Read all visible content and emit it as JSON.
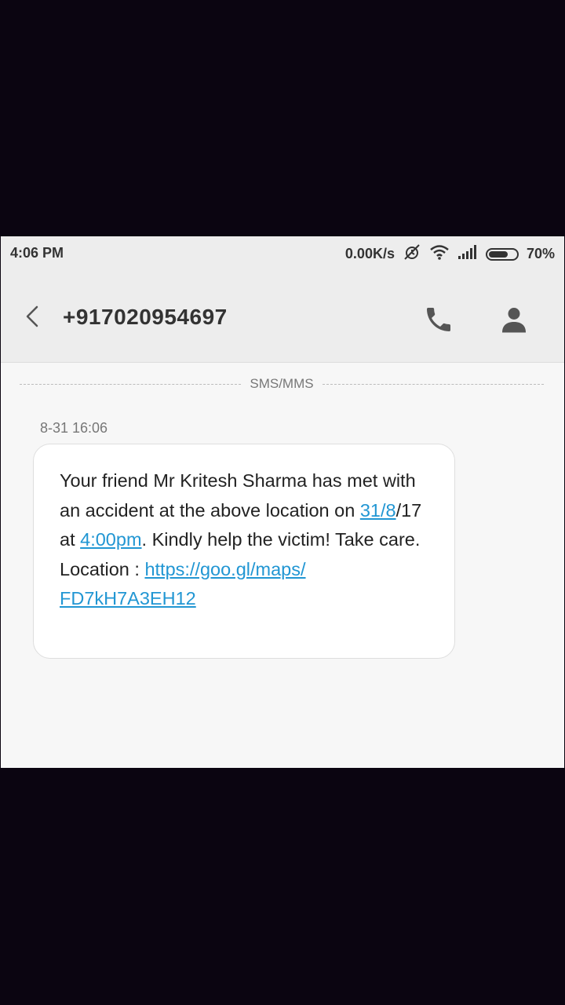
{
  "status_bar": {
    "time": "4:06 PM",
    "network_speed": "0.00K/s",
    "battery_percent": "70%",
    "battery_level": 0.7,
    "icons": [
      "alarm-off-icon",
      "wifi-icon",
      "signal-icon",
      "battery-icon"
    ]
  },
  "header": {
    "contact_number": "+917020954697",
    "icons": [
      "back-icon",
      "phone-icon",
      "person-icon"
    ]
  },
  "conversation": {
    "channel_label": "SMS/MMS",
    "messages": [
      {
        "timestamp": "8-31 16:06",
        "text_part1": "Your friend Mr Kritesh Sharma has met with an accident at the above location on ",
        "link_date": "31/8",
        "text_part2": "/17 at ",
        "link_time": "4:00pm",
        "text_part3": ". Kindly help the victim! Take care.",
        "location_label": "Location : ",
        "link_url_line1": "https://goo.gl/maps/",
        "link_url_line2": "FD7kH7A3EH12"
      }
    ]
  },
  "colors": {
    "link": "#2196d3",
    "header_bg": "#ededed",
    "screen_bg": "#f7f7f7",
    "outer_bg": "#0b0511"
  }
}
